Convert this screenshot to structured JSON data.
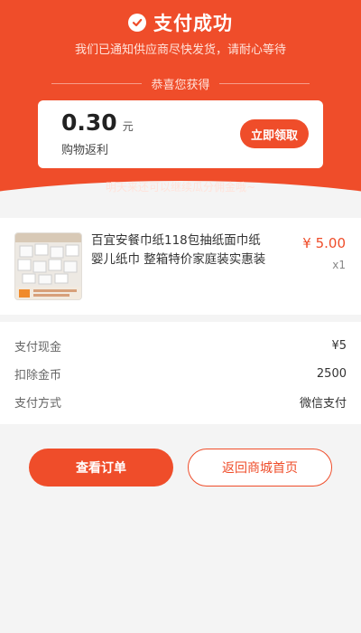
{
  "header": {
    "title": "支付成功",
    "subtitle": "我们已通知供应商尽快发货，请耐心等待",
    "gain_label": "恭喜您获得",
    "note": "明天来还可以继续瓜分佣金哦~",
    "bg_color": "#ef4d2a"
  },
  "reward": {
    "amount": "0.30",
    "unit": "元",
    "label": "购物返利",
    "claim_label": "立即领取"
  },
  "product": {
    "image_icon": "tissue-pack-photo",
    "name": "百宜安餐巾纸118包抽纸面巾纸婴儿纸巾 整箱特价家庭装实惠装",
    "price": "¥ 5.00",
    "quantity": "x1"
  },
  "payment_details": [
    {
      "label": "支付现金",
      "value": "¥5"
    },
    {
      "label": "扣除金币",
      "value": "2500"
    },
    {
      "label": "支付方式",
      "value": "微信支付"
    }
  ],
  "actions": {
    "view_order_label": "查看订单",
    "back_home_label": "返回商城首页"
  }
}
